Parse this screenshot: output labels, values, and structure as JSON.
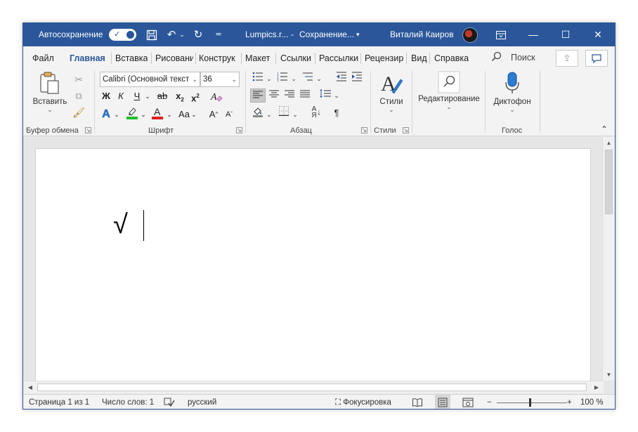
{
  "titlebar": {
    "autosave_label": "Автосохранение",
    "autosave_state": "on",
    "filename": "Lumpics.r...",
    "save_status": "Сохранение...",
    "user_name": "Виталий Каиров"
  },
  "tabs": [
    "Файл",
    "Главная",
    "Вставка",
    "Рисовани",
    "Конструк",
    "Макет",
    "Ссылки",
    "Рассылки",
    "Рецензир",
    "Вид",
    "Справка"
  ],
  "active_tab": "Главная",
  "search": {
    "label": "Поиск"
  },
  "ribbon": {
    "clipboard": {
      "paste_label": "Вставить",
      "group_label": "Буфер обмена"
    },
    "font": {
      "font_name": "Calibri (Основной текст",
      "font_size": "36",
      "bold": "Ж",
      "italic": "К",
      "underline": "Ч",
      "strike": "ab",
      "subscript_base": "x",
      "subscript": "2",
      "superscript_base": "x",
      "superscript": "2",
      "font_color_letter": "A",
      "change_case": "Aa",
      "grow": "A",
      "shrink": "A",
      "text_effects": "A",
      "group_label": "Шрифт",
      "highlight_color": "#22c02e",
      "font_color": "#e02020",
      "effects_color": "#2b7cd3"
    },
    "paragraph": {
      "group_label": "Абзац",
      "pilcrow": "¶",
      "sort": "АЯ"
    },
    "styles": {
      "label": "Стили",
      "group_label": "Стили"
    },
    "editing": {
      "label": "Редактирование"
    },
    "voice": {
      "label": "Диктофон",
      "group_label": "Голос"
    }
  },
  "document": {
    "text": "√"
  },
  "statusbar": {
    "page": "Страница 1 из 1",
    "words": "Число слов: 1",
    "language": "русский",
    "focus": "Фокусировка",
    "zoom_minus": "−",
    "zoom_plus": "+",
    "zoom": "100 %",
    "zoom_level_percent": 100
  }
}
